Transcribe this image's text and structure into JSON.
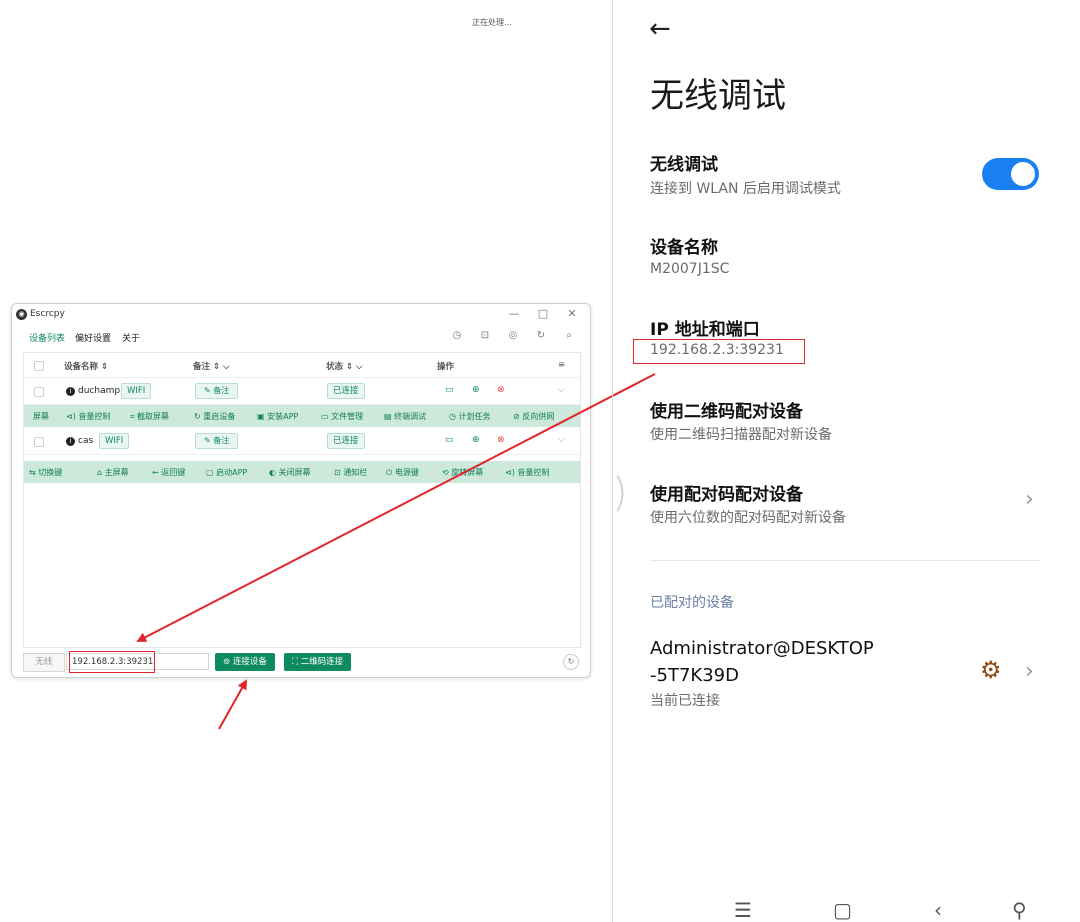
{
  "processing_text": "正在处理...",
  "escrcpy": {
    "title": "Escrcpy",
    "window_controls": [
      "—",
      "□",
      "✕"
    ],
    "menu": [
      "设备列表",
      "偏好设置",
      "关于"
    ],
    "columns": {
      "name": "设备名称 ⇕",
      "note": "备注 ⇕ ⌵",
      "status": "状态 ⇕ ⌵",
      "ops": "操作"
    },
    "devices": [
      {
        "name": "duchamp",
        "tag": "WIFI",
        "note": "✎ 备注",
        "status": "已连接"
      },
      {
        "name": "cas",
        "tag": "WIFI",
        "note": "✎ 备注",
        "status": "已连接"
      }
    ],
    "bar1": [
      "屏幕",
      "⊲) 音量控制",
      "⌗ 截取屏幕",
      "↻ 重启设备",
      "▣ 安装APP",
      "▭ 文件管理",
      "▤ 终端调试",
      "◷ 计划任务",
      "⊘ 反向供网"
    ],
    "bar2": [
      "⇆ 切换键",
      "⌂ 主屏幕",
      "← 返回键",
      "▢ 启动APP",
      "◐ 关闭屏幕",
      "⊡ 通知栏",
      "⏻ 电源键",
      "⟲ 旋转屏幕",
      "⊲) 音量控制"
    ],
    "mode_label": "无线",
    "ip_value": "192.168.2.3:39231",
    "connect_button": "⊚ 连接设备",
    "qr_button": "⛶ 二维码连接"
  },
  "phone": {
    "back": "←",
    "title": "无线调试",
    "wireless": {
      "title": "无线调试",
      "subtitle": "连接到 WLAN 后启用调试模式",
      "enabled": true,
      "accent": "#1a7ff0"
    },
    "device_name": {
      "title": "设备名称",
      "value": "M2007J1SC"
    },
    "ip_port": {
      "title": "IP 地址和端口",
      "value": "192.168.2.3:39231"
    },
    "qr_pair": {
      "title": "使用二维码配对设备",
      "subtitle": "使用二维码扫描器配对新设备"
    },
    "code_pair": {
      "title": "使用配对码配对设备",
      "subtitle": "使用六位数的配对码配对新设备"
    },
    "paired_section": "已配对的设备",
    "paired_device": {
      "name_line1": "Administrator@DESKTOP",
      "name_line2": "-5T7K39D",
      "status": "当前已连接"
    },
    "nav": [
      "☰",
      "▢",
      "‹",
      "⚲"
    ]
  },
  "annotation_color": "#e0262a"
}
